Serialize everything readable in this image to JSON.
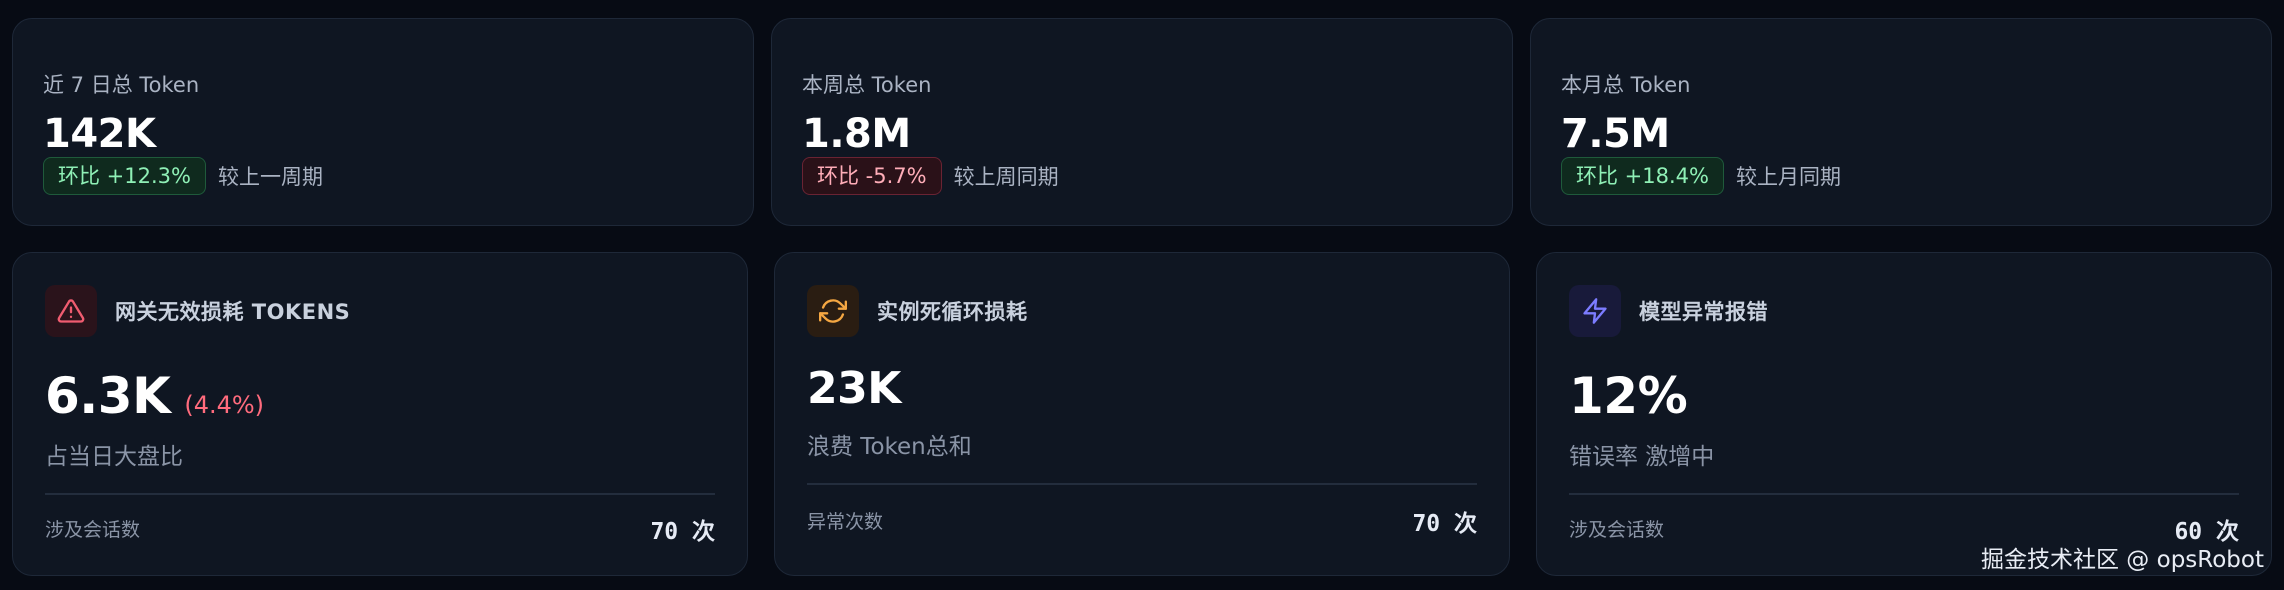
{
  "summary_cards": [
    {
      "title": "近 7 日总 Token",
      "value": "142K",
      "delta": "环比 +12.3%",
      "delta_note": "较上一周期",
      "trend": "up"
    },
    {
      "title": "本周总 Token",
      "value": "1.8M",
      "delta": "环比 -5.7%",
      "delta_note": "较上周同期",
      "trend": "down"
    },
    {
      "title": "本月总 Token",
      "value": "7.5M",
      "delta": "环比 +18.4%",
      "delta_note": "较上月同期",
      "trend": "up"
    }
  ],
  "metric_cards": [
    {
      "icon": "warning-triangle-icon",
      "icon_color": "#f05c70",
      "title": "网关无效损耗 TOKENS",
      "value": "6.3K",
      "value_extra": "(4.4%)",
      "subtitle": "占当日大盘比",
      "footer_label": "涉及会话数",
      "footer_value": "70 次"
    },
    {
      "icon": "refresh-cycle-icon",
      "icon_color": "#f5a742",
      "title": "实例死循环损耗",
      "value": "23K",
      "value_extra": "",
      "subtitle": "浪费 Token总和",
      "footer_label": "异常次数",
      "footer_value": "70 次"
    },
    {
      "icon": "lightning-bolt-icon",
      "icon_color": "#7c7cff",
      "title": "模型异常报错",
      "value": "12%",
      "value_extra": "",
      "subtitle": "错误率 激增中",
      "footer_label": "涉及会话数",
      "footer_value": "60 次"
    }
  ],
  "watermark": "掘金技术社区 @ opsRobot",
  "colors": {
    "background": "#070b14",
    "card": "#0f1622",
    "up": "#8ff0b6",
    "down": "#ffadb8",
    "danger_text": "#ff6b7d"
  }
}
